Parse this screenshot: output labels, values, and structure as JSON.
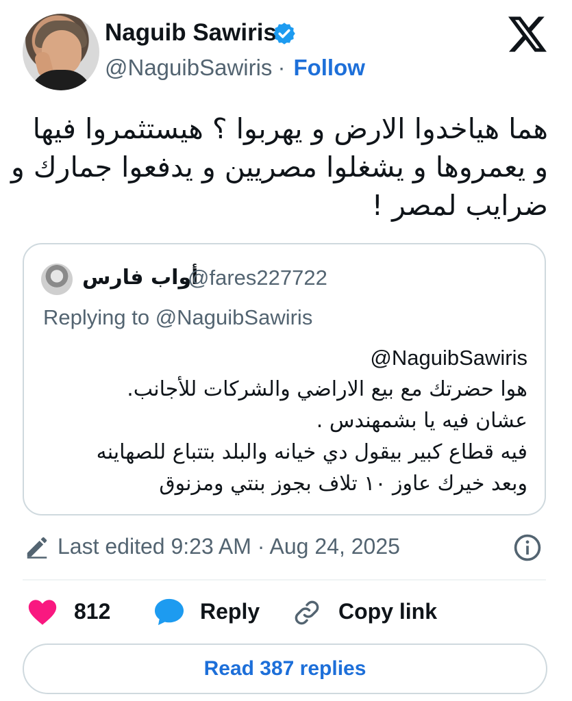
{
  "author": {
    "name": "Naguib Sawiris",
    "handle": "@NaguibSawiris",
    "separator": "·",
    "follow_label": "Follow",
    "verified": true
  },
  "icons": {
    "verified": "verified-badge-icon",
    "platform": "x-logo-icon",
    "edit": "pencil-icon",
    "info": "info-icon",
    "like": "heart-icon",
    "reply": "chat-bubble-icon",
    "copy": "link-icon"
  },
  "tweet": {
    "lines": [
      "هما هياخدوا الارض و يهربوا ؟ هيستثمروا  فيها",
      "و يعمروها و يشغلوا مصريين و يدفعوا جمارك و",
      "ضرايب لمصر !"
    ]
  },
  "quote": {
    "name": "أواب فارس",
    "handle": "@fares227722",
    "replying_to": "Replying to @NaguibSawiris",
    "mention": "@NaguibSawiris",
    "lines": [
      "هوا حضرتك مع بيع الاراضي والشركات للأجانب.",
      "عشان فيه يا بشمهندس .",
      "فيه قطاع كبير بيقول دي خيانه والبلد بتتباع للصهاينه",
      "وبعد خيرك عاوز ١٠ تلاف بجوز بنتي ومزنوق"
    ]
  },
  "meta": {
    "edited": "Last edited 9:23 AM · Aug 24, 2025"
  },
  "actions": {
    "likes": "812",
    "reply_label": "Reply",
    "copy_label": "Copy link",
    "read_replies": "Read 387 replies"
  },
  "colors": {
    "accent": "#1d6fd9",
    "heart": "#f91880",
    "bubble": "#1d9bf0",
    "muted": "#536471",
    "border": "#cfd9de"
  }
}
